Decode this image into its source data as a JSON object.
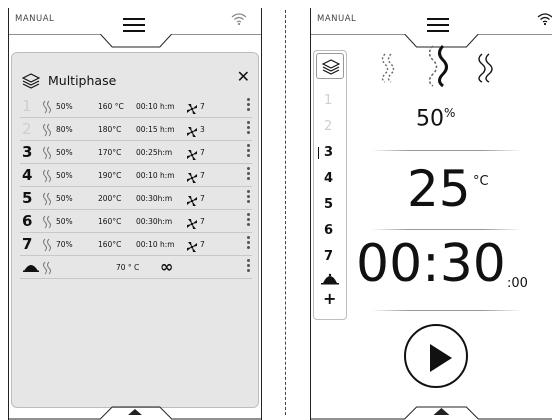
{
  "left_screen": {
    "mode_label": "MANUAL",
    "overlay": {
      "title": "Multiphase",
      "close_label": "✕",
      "phases": [
        {
          "num": "1",
          "humidity": "50%",
          "temp": "160 °C",
          "time": "00:10 h:m",
          "fan": "7",
          "enabled": false
        },
        {
          "num": "2",
          "humidity": "80%",
          "temp": "180°C",
          "time": "00:15 h:m",
          "fan": "3",
          "enabled": false
        },
        {
          "num": "3",
          "humidity": "50%",
          "temp": "170°C",
          "time": "00:25h:m",
          "fan": "7",
          "enabled": true
        },
        {
          "num": "4",
          "humidity": "50%",
          "temp": "190°C",
          "time": "00:10 h:m",
          "fan": "7",
          "enabled": true
        },
        {
          "num": "5",
          "humidity": "50%",
          "temp": "200°C",
          "time": "00:30h:m",
          "fan": "7",
          "enabled": true
        },
        {
          "num": "6",
          "humidity": "50%",
          "temp": "160°C",
          "time": "00:30h:m",
          "fan": "7",
          "enabled": true
        },
        {
          "num": "7",
          "humidity": "70%",
          "temp": "160°C",
          "time": "00:10 h:m",
          "fan": "7",
          "enabled": true
        }
      ],
      "holding": {
        "temp": "70 ° C",
        "time": "∞"
      }
    }
  },
  "right_screen": {
    "mode_label": "MANUAL",
    "sidebar": {
      "items": [
        "1",
        "2",
        "3",
        "4",
        "5",
        "6",
        "7"
      ],
      "active": "3",
      "dim": [
        "1",
        "2"
      ],
      "add_label": "+"
    },
    "humidity": "50",
    "humidity_unit": "%",
    "temperature": "25",
    "temperature_unit": "°C",
    "time": "00:30",
    "time_seconds": ":00"
  },
  "icons": {
    "menu": "menu-icon",
    "wifi": "wifi-icon",
    "layers": "layers-icon",
    "steam": "steam-icon",
    "fan": "fan-icon",
    "holding": "cloche-icon",
    "play": "play-icon",
    "up": "chevron-up-icon"
  },
  "colors": {
    "overlay_bg": "#e6e6e6",
    "disabled_text": "#cfcfcf",
    "ink": "#111111"
  }
}
